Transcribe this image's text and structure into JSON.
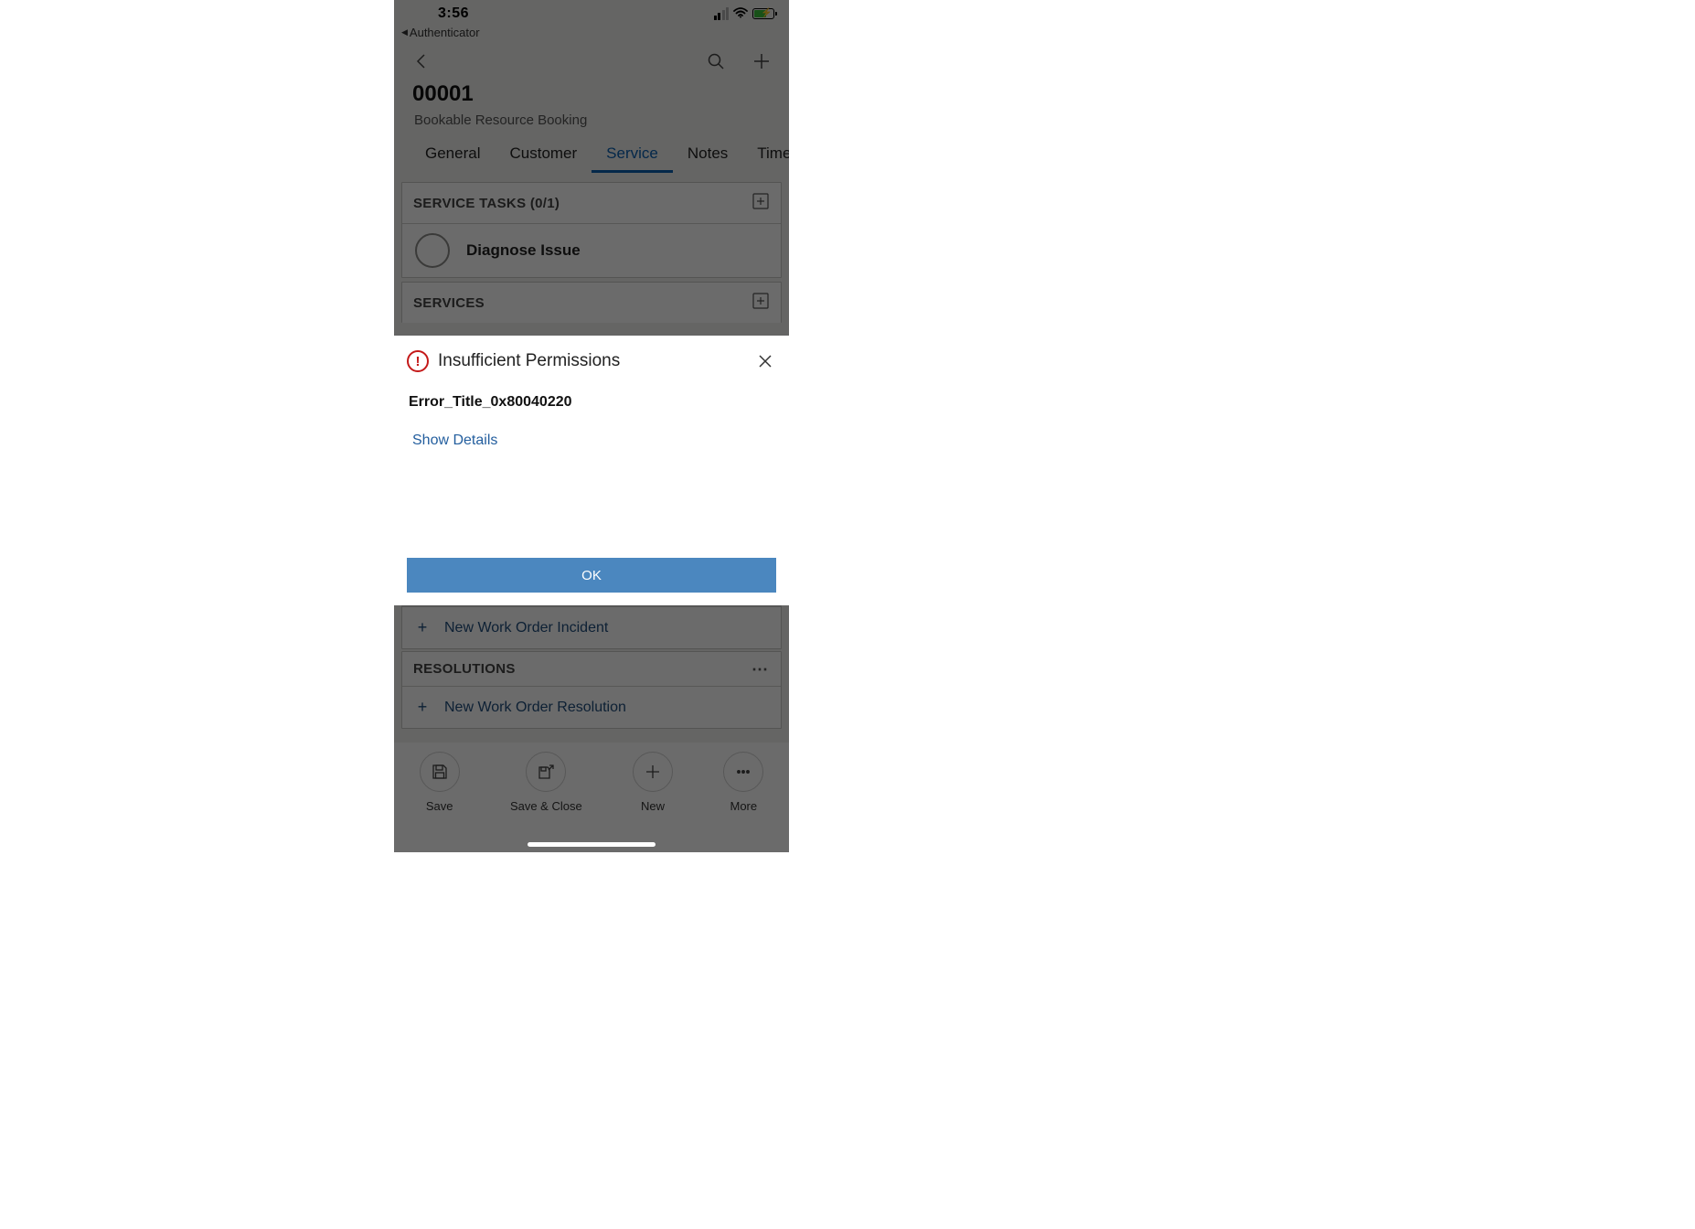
{
  "status": {
    "time": "3:56",
    "back_app": "Authenticator"
  },
  "header": {
    "title": "00001",
    "subtitle": "Bookable Resource Booking"
  },
  "tabs": {
    "items": [
      {
        "label": "General"
      },
      {
        "label": "Customer"
      },
      {
        "label": "Service"
      },
      {
        "label": "Notes"
      },
      {
        "label": "Timeline"
      }
    ],
    "active_index": 2
  },
  "sections": {
    "service_tasks": {
      "header": "SERVICE TASKS (0/1)",
      "items": [
        {
          "label": "Diagnose Issue"
        }
      ]
    },
    "services": {
      "header": "SERVICES"
    },
    "incidents": {
      "add_label": "New Work Order Incident"
    },
    "resolutions": {
      "header": "RESOLUTIONS",
      "add_label": "New Work Order Resolution"
    }
  },
  "toolbar": {
    "save": "Save",
    "save_close": "Save & Close",
    "new": "New",
    "more": "More"
  },
  "modal": {
    "title": "Insufficient Permissions",
    "error_code": "Error_Title_0x80040220",
    "show_details": "Show Details",
    "ok": "OK"
  }
}
